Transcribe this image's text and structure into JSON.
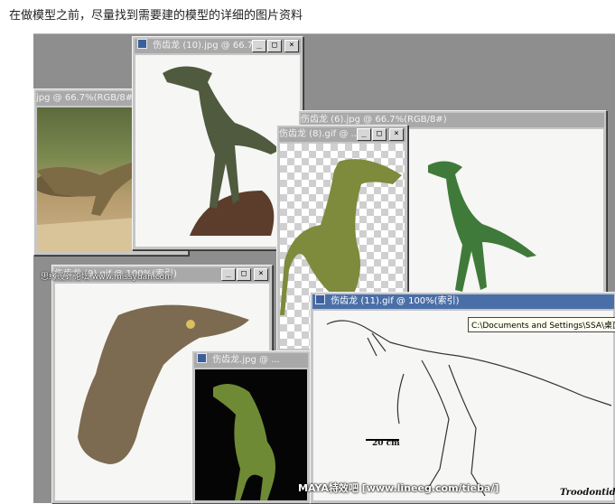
{
  "caption": "在做模型之前，尽量找到需要建的模型的详细的图片资料",
  "windows": {
    "w_left": {
      "title": "jpg @ 66.7%(RGB/8#)"
    },
    "w_top": {
      "title": "伤齿龙 (10).jpg @ 66.7..."
    },
    "w_mid": {
      "title": "伤齿龙 (6).jpg @ 66.7%(RGB/8#)"
    },
    "w_green": {
      "title": "伤齿龙 (8).gif @ ..."
    },
    "w_head": {
      "title": "伤齿龙 (9).gif @ 100%(索引)"
    },
    "w_black": {
      "title": "伤齿龙.jpg @ ..."
    },
    "w_skel": {
      "title": "伤齿龙 (11).gif @ 100%(索引)"
    }
  },
  "buttons": {
    "minimize": "_",
    "maximize": "□",
    "close": "×"
  },
  "tooltip": "C:\\Documents and Settings\\SSA\\桌面\\伤",
  "scale_label": "20 cm",
  "skel_caption": "Troodontid",
  "watermark": "思缘设计论坛 www.missyuan.com",
  "footer": "MAYA特效吧 [www.lineeg.com/tieba/]"
}
